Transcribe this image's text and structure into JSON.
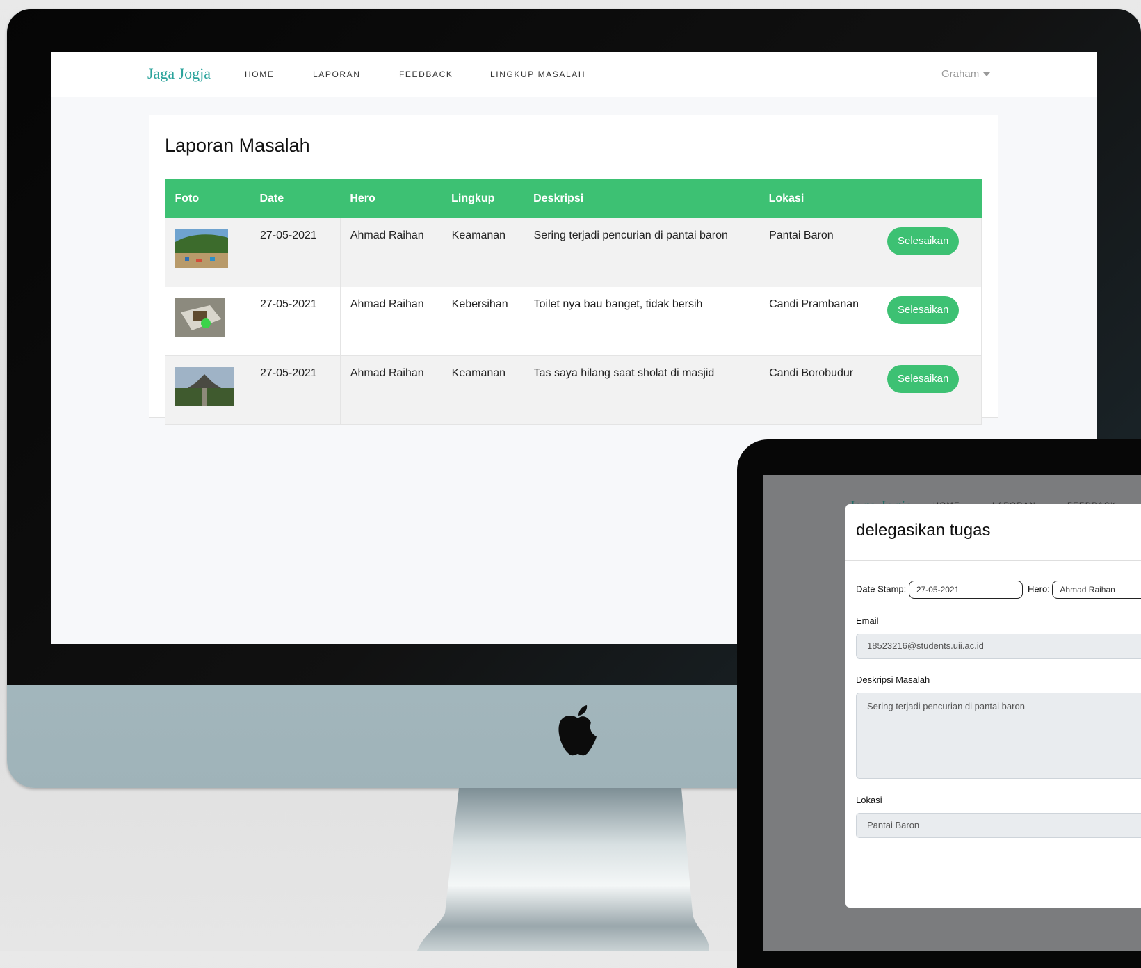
{
  "main_page": {
    "brand": "Jaga Jogja",
    "nav": [
      "HOME",
      "LAPORAN",
      "FEEDBACK",
      "LINGKUP MASALAH"
    ],
    "user": "Graham",
    "card_title": "Laporan Masalah",
    "table": {
      "headers": [
        "Foto",
        "Date",
        "Hero",
        "Lingkup",
        "Deskripsi",
        "Lokasi"
      ],
      "rows": [
        {
          "date": "27-05-2021",
          "hero": "Ahmad Raihan",
          "lingkup": "Keamanan",
          "deskripsi": "Sering terjadi pencurian di pantai baron",
          "lokasi": "Pantai Baron",
          "action": "Selesaikan"
        },
        {
          "date": "27-05-2021",
          "hero": "Ahmad Raihan",
          "lingkup": "Kebersihan",
          "deskripsi": "Toilet nya bau banget, tidak bersih",
          "lokasi": "Candi Prambanan",
          "action": "Selesaikan"
        },
        {
          "date": "27-05-2021",
          "hero": "Ahmad Raihan",
          "lingkup": "Keamanan",
          "deskripsi": "Tas saya hilang saat sholat di masjid",
          "lokasi": "Candi Borobudur",
          "action": "Selesaikan"
        }
      ]
    }
  },
  "modal_page": {
    "ghost_brand": "Jaga Jogja",
    "ghost_nav": [
      "HOME",
      "LAPORAN",
      "FEEDBACK"
    ],
    "title": "delegasikan tugas",
    "date_stamp_label": "Date Stamp:",
    "date_stamp_value": "27-05-2021",
    "hero_label": "Hero:",
    "hero_value": "Ahmad Raihan",
    "email_label": "Email",
    "email_value": "18523216@students.uii.ac.id",
    "deskripsi_label": "Deskripsi Masalah",
    "deskripsi_value": "Sering terjadi pencurian di pantai  baron",
    "lokasi_label": "Lokasi",
    "lokasi_value": "Pantai Baron"
  },
  "colors": {
    "accent_green": "#3dc173",
    "brand_teal": "#2aa39b"
  }
}
